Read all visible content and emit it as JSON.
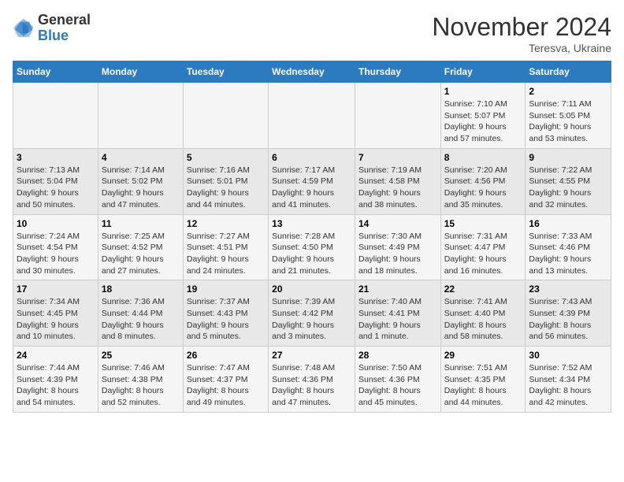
{
  "logo": {
    "general": "General",
    "blue": "Blue"
  },
  "header": {
    "month": "November 2024",
    "location": "Teresva, Ukraine"
  },
  "weekdays": [
    "Sunday",
    "Monday",
    "Tuesday",
    "Wednesday",
    "Thursday",
    "Friday",
    "Saturday"
  ],
  "weeks": [
    [
      {
        "day": "",
        "info": ""
      },
      {
        "day": "",
        "info": ""
      },
      {
        "day": "",
        "info": ""
      },
      {
        "day": "",
        "info": ""
      },
      {
        "day": "",
        "info": ""
      },
      {
        "day": "1",
        "info": "Sunrise: 7:10 AM\nSunset: 5:07 PM\nDaylight: 9 hours\nand 57 minutes."
      },
      {
        "day": "2",
        "info": "Sunrise: 7:11 AM\nSunset: 5:05 PM\nDaylight: 9 hours\nand 53 minutes."
      }
    ],
    [
      {
        "day": "3",
        "info": "Sunrise: 7:13 AM\nSunset: 5:04 PM\nDaylight: 9 hours\nand 50 minutes."
      },
      {
        "day": "4",
        "info": "Sunrise: 7:14 AM\nSunset: 5:02 PM\nDaylight: 9 hours\nand 47 minutes."
      },
      {
        "day": "5",
        "info": "Sunrise: 7:16 AM\nSunset: 5:01 PM\nDaylight: 9 hours\nand 44 minutes."
      },
      {
        "day": "6",
        "info": "Sunrise: 7:17 AM\nSunset: 4:59 PM\nDaylight: 9 hours\nand 41 minutes."
      },
      {
        "day": "7",
        "info": "Sunrise: 7:19 AM\nSunset: 4:58 PM\nDaylight: 9 hours\nand 38 minutes."
      },
      {
        "day": "8",
        "info": "Sunrise: 7:20 AM\nSunset: 4:56 PM\nDaylight: 9 hours\nand 35 minutes."
      },
      {
        "day": "9",
        "info": "Sunrise: 7:22 AM\nSunset: 4:55 PM\nDaylight: 9 hours\nand 32 minutes."
      }
    ],
    [
      {
        "day": "10",
        "info": "Sunrise: 7:24 AM\nSunset: 4:54 PM\nDaylight: 9 hours\nand 30 minutes."
      },
      {
        "day": "11",
        "info": "Sunrise: 7:25 AM\nSunset: 4:52 PM\nDaylight: 9 hours\nand 27 minutes."
      },
      {
        "day": "12",
        "info": "Sunrise: 7:27 AM\nSunset: 4:51 PM\nDaylight: 9 hours\nand 24 minutes."
      },
      {
        "day": "13",
        "info": "Sunrise: 7:28 AM\nSunset: 4:50 PM\nDaylight: 9 hours\nand 21 minutes."
      },
      {
        "day": "14",
        "info": "Sunrise: 7:30 AM\nSunset: 4:49 PM\nDaylight: 9 hours\nand 18 minutes."
      },
      {
        "day": "15",
        "info": "Sunrise: 7:31 AM\nSunset: 4:47 PM\nDaylight: 9 hours\nand 16 minutes."
      },
      {
        "day": "16",
        "info": "Sunrise: 7:33 AM\nSunset: 4:46 PM\nDaylight: 9 hours\nand 13 minutes."
      }
    ],
    [
      {
        "day": "17",
        "info": "Sunrise: 7:34 AM\nSunset: 4:45 PM\nDaylight: 9 hours\nand 10 minutes."
      },
      {
        "day": "18",
        "info": "Sunrise: 7:36 AM\nSunset: 4:44 PM\nDaylight: 9 hours\nand 8 minutes."
      },
      {
        "day": "19",
        "info": "Sunrise: 7:37 AM\nSunset: 4:43 PM\nDaylight: 9 hours\nand 5 minutes."
      },
      {
        "day": "20",
        "info": "Sunrise: 7:39 AM\nSunset: 4:42 PM\nDaylight: 9 hours\nand 3 minutes."
      },
      {
        "day": "21",
        "info": "Sunrise: 7:40 AM\nSunset: 4:41 PM\nDaylight: 9 hours\nand 1 minute."
      },
      {
        "day": "22",
        "info": "Sunrise: 7:41 AM\nSunset: 4:40 PM\nDaylight: 8 hours\nand 58 minutes."
      },
      {
        "day": "23",
        "info": "Sunrise: 7:43 AM\nSunset: 4:39 PM\nDaylight: 8 hours\nand 56 minutes."
      }
    ],
    [
      {
        "day": "24",
        "info": "Sunrise: 7:44 AM\nSunset: 4:39 PM\nDaylight: 8 hours\nand 54 minutes."
      },
      {
        "day": "25",
        "info": "Sunrise: 7:46 AM\nSunset: 4:38 PM\nDaylight: 8 hours\nand 52 minutes."
      },
      {
        "day": "26",
        "info": "Sunrise: 7:47 AM\nSunset: 4:37 PM\nDaylight: 8 hours\nand 49 minutes."
      },
      {
        "day": "27",
        "info": "Sunrise: 7:48 AM\nSunset: 4:36 PM\nDaylight: 8 hours\nand 47 minutes."
      },
      {
        "day": "28",
        "info": "Sunrise: 7:50 AM\nSunset: 4:36 PM\nDaylight: 8 hours\nand 45 minutes."
      },
      {
        "day": "29",
        "info": "Sunrise: 7:51 AM\nSunset: 4:35 PM\nDaylight: 8 hours\nand 44 minutes."
      },
      {
        "day": "30",
        "info": "Sunrise: 7:52 AM\nSunset: 4:34 PM\nDaylight: 8 hours\nand 42 minutes."
      }
    ]
  ]
}
